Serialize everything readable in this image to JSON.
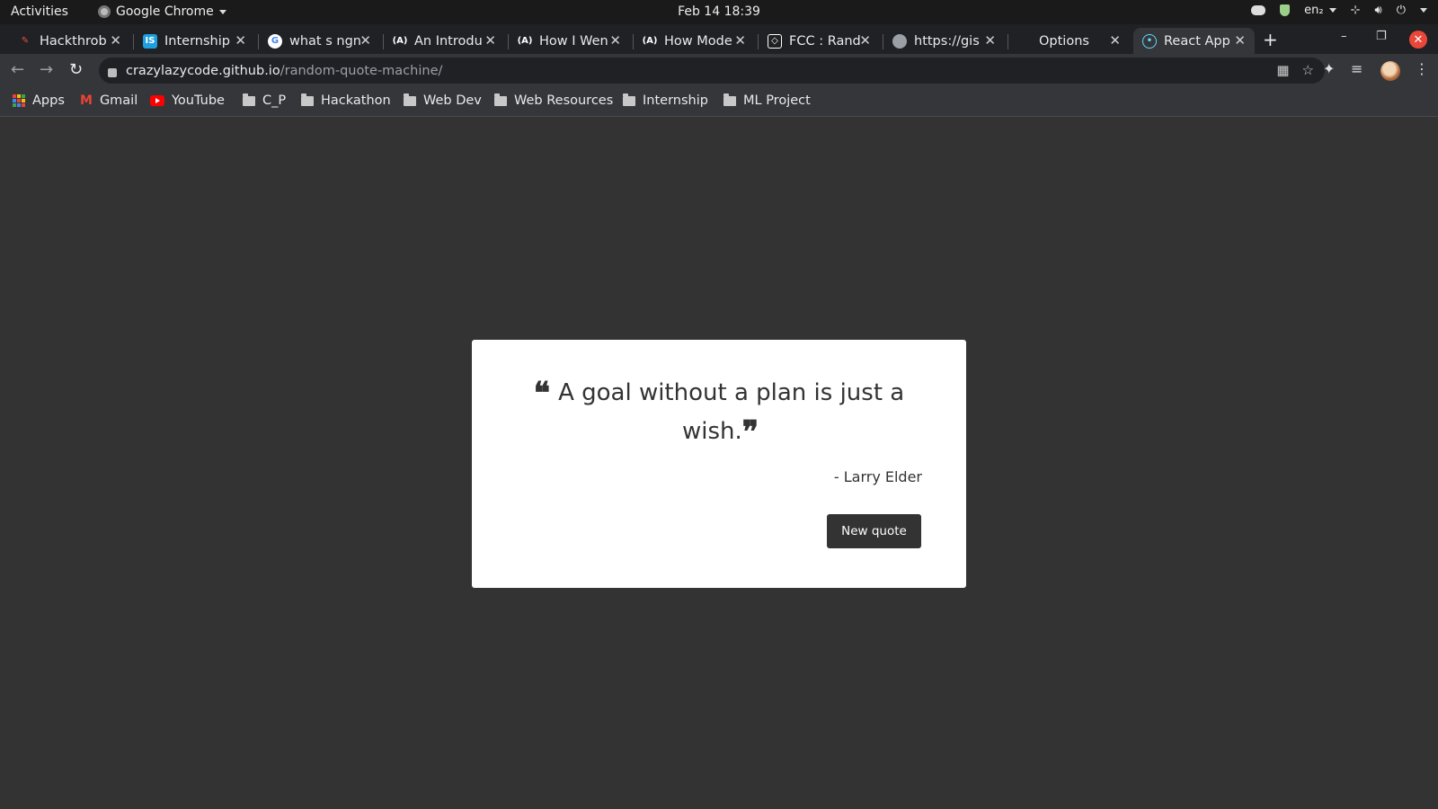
{
  "system_bar": {
    "activities": "Activities",
    "app_name": "Google Chrome",
    "datetime": "Feb 14  18:39",
    "keyboard_layout": "en₂"
  },
  "tabs": [
    {
      "title": "Hackthrob",
      "favicon": "hackthrob-icon"
    },
    {
      "title": "Internship",
      "favicon": "internshala-icon"
    },
    {
      "title": "what s ngn",
      "favicon": "google-icon"
    },
    {
      "title": "An Introdu",
      "favicon": "angular-icon"
    },
    {
      "title": "How I Wen",
      "favicon": "angular-icon"
    },
    {
      "title": "How Mode",
      "favicon": "angular-icon"
    },
    {
      "title": "FCC : Rand",
      "favicon": "codepen-icon"
    },
    {
      "title": "https://gis",
      "favicon": "github-icon"
    },
    {
      "title": "Options",
      "favicon": "blank-icon"
    },
    {
      "title": "React App",
      "favicon": "react-icon",
      "active": true
    }
  ],
  "address_bar": {
    "host": "crazylazycode.github.io",
    "path": "/random-quote-machine/"
  },
  "bookmarks": [
    {
      "label": "Apps",
      "icon": "apps-grid-icon"
    },
    {
      "label": "Gmail",
      "icon": "gmail-icon"
    },
    {
      "label": "YouTube",
      "icon": "youtube-icon"
    },
    {
      "label": "C_P",
      "icon": "folder-icon"
    },
    {
      "label": "Hackathon",
      "icon": "folder-icon"
    },
    {
      "label": "Web Dev",
      "icon": "folder-icon"
    },
    {
      "label": "Web Resources",
      "icon": "folder-icon"
    },
    {
      "label": "Internship",
      "icon": "folder-icon"
    },
    {
      "label": "ML Project",
      "icon": "folder-icon"
    }
  ],
  "quote": {
    "open_mark": "❝",
    "text": "A goal without a plan is just a wish.",
    "close_mark": "❞",
    "author": "- Larry Elder",
    "button_label": "New quote"
  },
  "colors": {
    "page_background": "#333333",
    "card_background": "#ffffff",
    "accent": "#333333"
  }
}
